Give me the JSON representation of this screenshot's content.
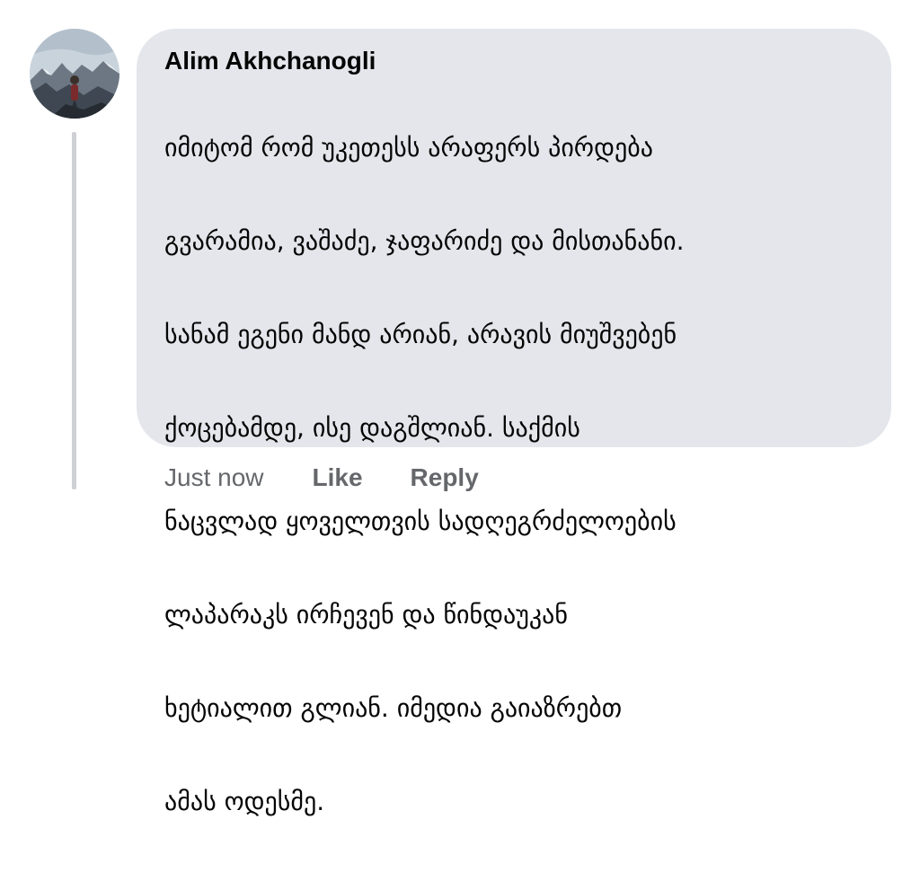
{
  "comment": {
    "author": "Alim Akhchanogli",
    "avatar_icon": "profile-photo-mountain",
    "lines": [
      "იმიტომ რომ უკეთესს არაფერს პირდება",
      "გვარამია, ვაშაძე, ჯაფარიძე და მისთანანი.",
      "სანამ ეგენი მანდ არიან, არავის მიუშვებენ",
      "ქოცებამდე, ისე დაგშლიან. საქმის",
      "ნაცვლად ყოველთვის სადღეგრძელოების",
      "ლაპარაკს ირჩევენ და წინდაუკან",
      "ხეტიალით გლიან. იმედია გაიაზრებთ",
      "ამას ოდესმე."
    ]
  },
  "actions": {
    "time": "Just now",
    "like": "Like",
    "reply": "Reply"
  },
  "colors": {
    "bubble": "#e4e6eb",
    "text": "#050505",
    "secondary": "#65676b",
    "thread_line": "#ced0d4"
  }
}
